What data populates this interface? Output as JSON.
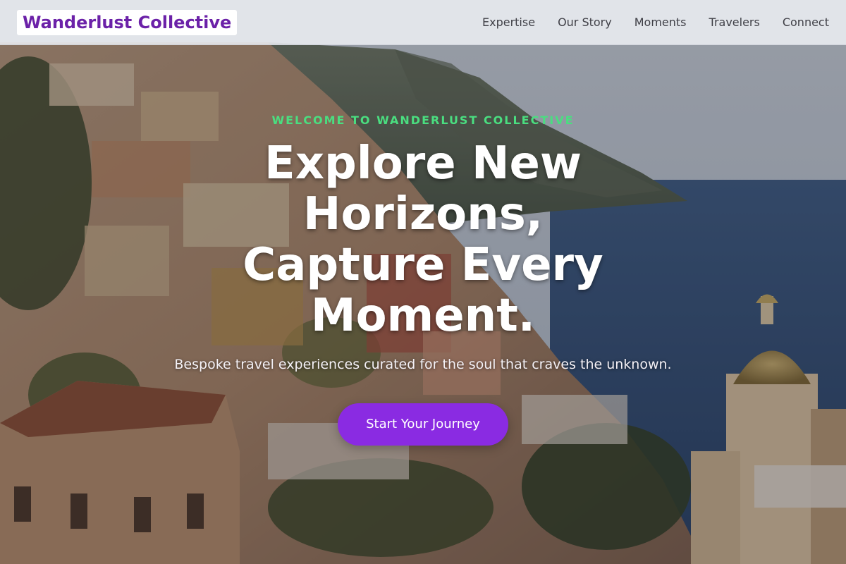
{
  "brand": {
    "name": "Wanderlust Collective",
    "color": "#6b21a8"
  },
  "nav": {
    "items": [
      {
        "label": "Expertise"
      },
      {
        "label": "Our Story"
      },
      {
        "label": "Moments"
      },
      {
        "label": "Travelers"
      },
      {
        "label": "Connect"
      }
    ]
  },
  "hero": {
    "eyebrow": "Welcome to Wanderlust Collective",
    "headline": "Explore New Horizons, Capture Every Moment.",
    "subtitle": "Bespoke travel experiences curated for the soul that craves the unknown.",
    "cta_label": "Start Your Journey",
    "background_image": "coastal-hillside-town-photo",
    "colors": {
      "eyebrow": "#4ade80",
      "cta": "#8a2be2"
    }
  }
}
